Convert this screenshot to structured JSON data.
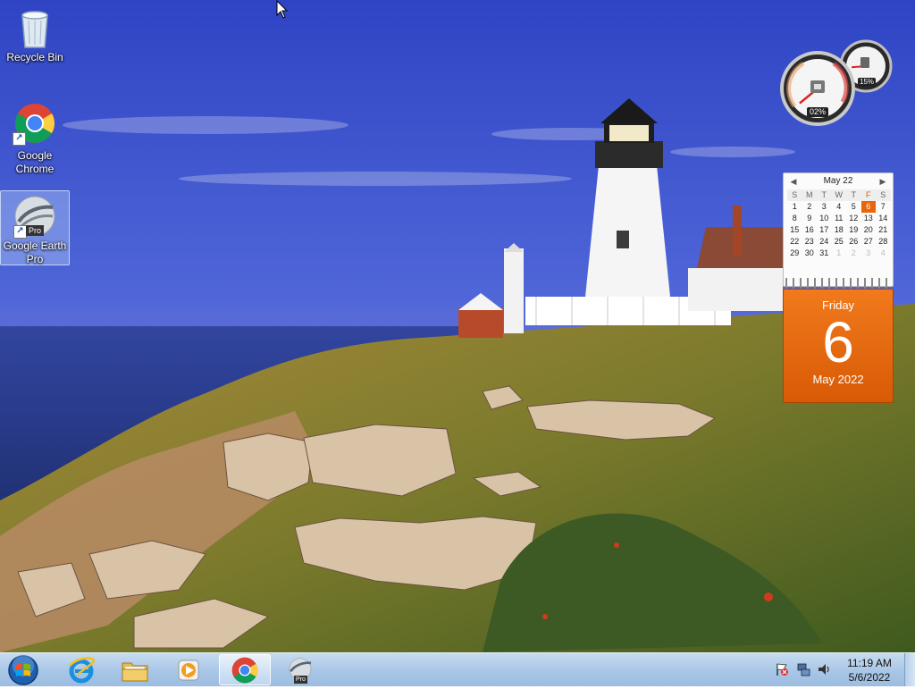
{
  "desktop": {
    "icons": [
      {
        "label": "Recycle Bin",
        "icon": "recycle-bin-icon"
      },
      {
        "label": "Google Chrome",
        "icon": "chrome-icon"
      },
      {
        "label": "Google Earth Pro",
        "icon": "google-earth-pro-icon",
        "badge": "Pro",
        "selected": true
      }
    ]
  },
  "gadgets": {
    "cpu_meter": {
      "cpu_percent_label": "02%",
      "memory_percent_label": "15%",
      "cpu_percent": 2,
      "memory_percent": 15
    },
    "calendar": {
      "month_title": "May 22",
      "day_headers": [
        "S",
        "M",
        "T",
        "W",
        "T",
        "F",
        "S"
      ],
      "weeks": [
        [
          "1",
          "2",
          "3",
          "4",
          "5",
          "6",
          "7"
        ],
        [
          "8",
          "9",
          "10",
          "11",
          "12",
          "13",
          "14"
        ],
        [
          "15",
          "16",
          "17",
          "18",
          "19",
          "20",
          "21"
        ],
        [
          "22",
          "23",
          "24",
          "25",
          "26",
          "27",
          "28"
        ],
        [
          "29",
          "30",
          "31",
          "1",
          "2",
          "3",
          "4"
        ]
      ],
      "today_weekday": "Friday",
      "today_day": "6",
      "today_month_year": "May 2022",
      "accent_color": "#e8650a"
    }
  },
  "taskbar": {
    "pinned": [
      {
        "name": "internet-explorer",
        "icon": "internet-explorer-icon"
      },
      {
        "name": "file-explorer",
        "icon": "folder-icon"
      },
      {
        "name": "media-player",
        "icon": "media-player-icon"
      },
      {
        "name": "google-chrome",
        "icon": "chrome-icon",
        "active": true
      },
      {
        "name": "google-earth-pro",
        "icon": "google-earth-pro-icon",
        "badge": "Pro"
      }
    ],
    "tray": {
      "icons": [
        "action-center-flag-icon",
        "network-icon",
        "volume-icon"
      ],
      "clock_time": "11:19 AM",
      "clock_date": "5/6/2022"
    }
  }
}
